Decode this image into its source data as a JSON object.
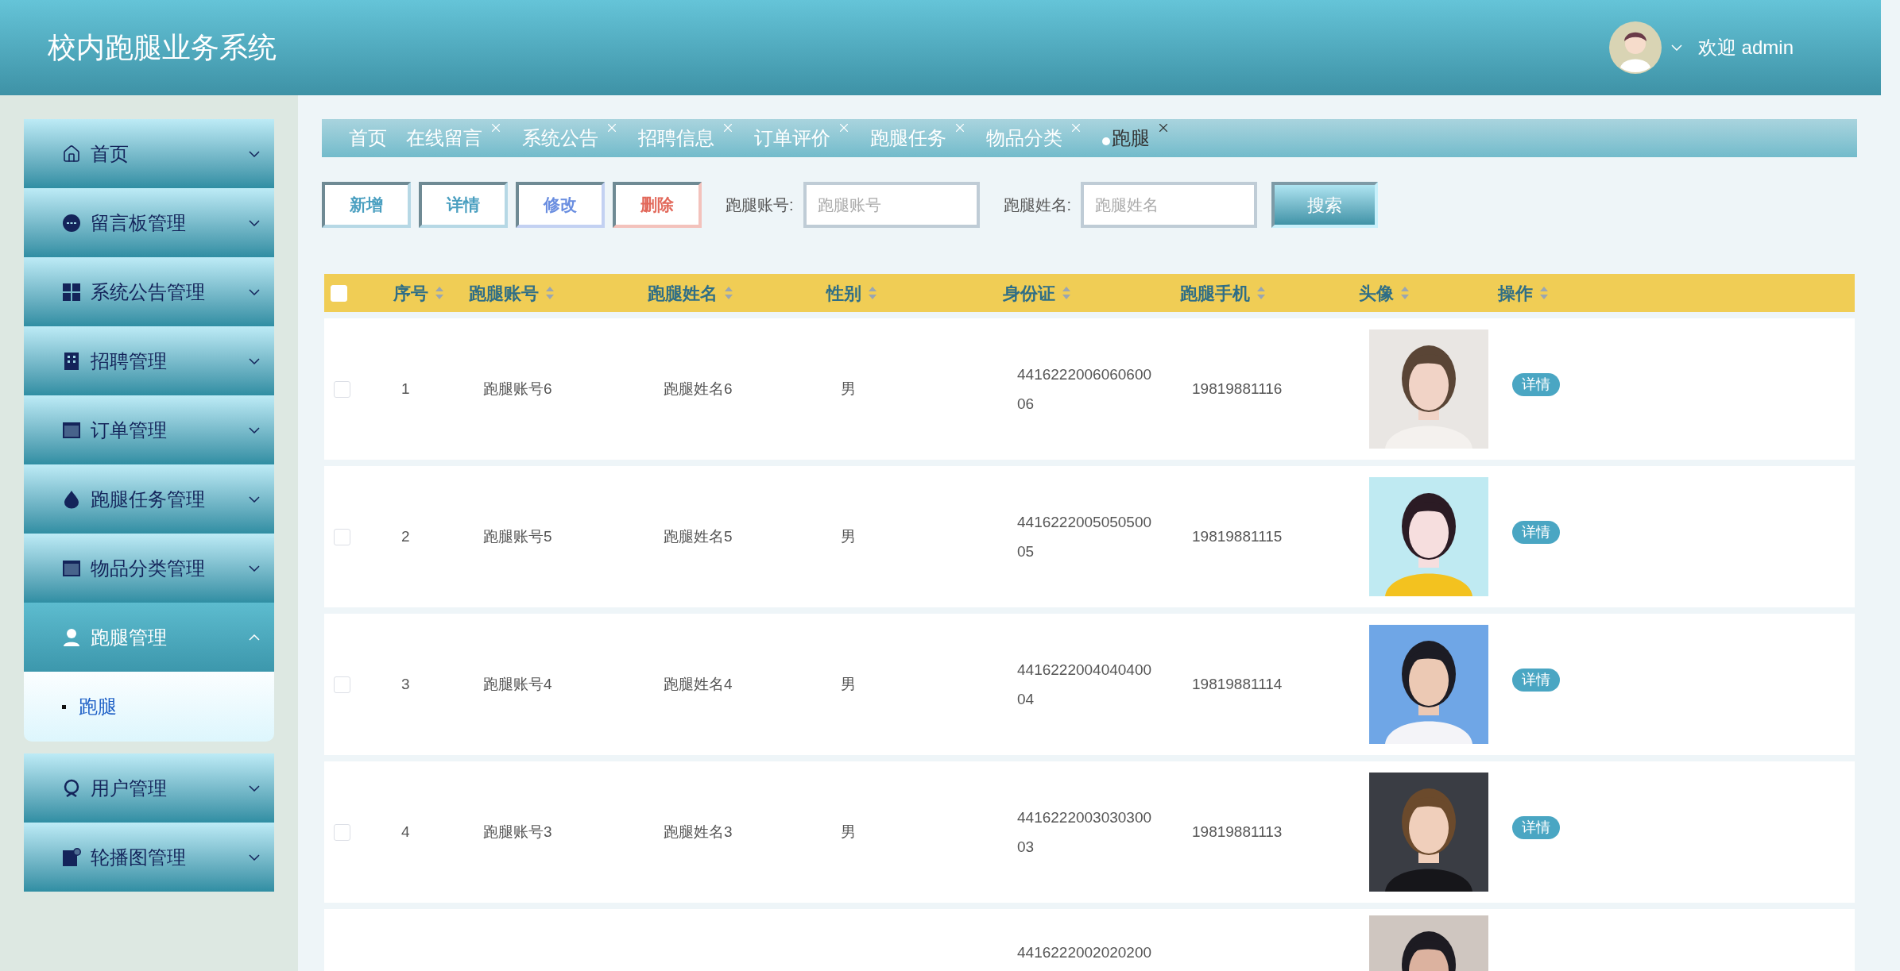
{
  "header": {
    "title": "校内跑腿业务系统",
    "welcome": "欢迎 admin"
  },
  "sidebar": {
    "items": [
      {
        "label": "首页",
        "expanded": false
      },
      {
        "label": "留言板管理",
        "expanded": false
      },
      {
        "label": "系统公告管理",
        "expanded": false
      },
      {
        "label": "招聘管理",
        "expanded": false
      },
      {
        "label": "订单管理",
        "expanded": false
      },
      {
        "label": "跑腿任务管理",
        "expanded": false
      },
      {
        "label": "物品分类管理",
        "expanded": false
      },
      {
        "label": "跑腿管理",
        "expanded": true,
        "children": [
          {
            "label": "跑腿",
            "selected": true
          }
        ]
      },
      {
        "label": "用户管理",
        "expanded": false
      },
      {
        "label": "轮播图管理",
        "expanded": false
      }
    ]
  },
  "tabs": [
    {
      "label": "首页",
      "closable": false,
      "selected": false
    },
    {
      "label": "在线留言",
      "closable": true,
      "selected": false
    },
    {
      "label": "系统公告",
      "closable": true,
      "selected": false
    },
    {
      "label": "招聘信息",
      "closable": true,
      "selected": false
    },
    {
      "label": "订单评价",
      "closable": true,
      "selected": false
    },
    {
      "label": "跑腿任务",
      "closable": true,
      "selected": false
    },
    {
      "label": "物品分类",
      "closable": true,
      "selected": false
    },
    {
      "label": "跑腿",
      "closable": true,
      "selected": true
    }
  ],
  "actions": [
    {
      "label": "新增",
      "color": "#4a9fc0"
    },
    {
      "label": "详情",
      "color": "#4a9fc0"
    },
    {
      "label": "修改",
      "color": "#6a8ee0"
    },
    {
      "label": "删除",
      "color": "#e2685a"
    }
  ],
  "filters": [
    {
      "label": "跑腿账号:",
      "placeholder": "跑腿账号"
    },
    {
      "label": "跑腿姓名:",
      "placeholder": "跑腿姓名"
    }
  ],
  "search_button": "搜索",
  "table": {
    "select_all_checked": false,
    "columns": [
      "序号",
      "跑腿账号",
      "跑腿姓名",
      "性别",
      "身份证",
      "跑腿手机",
      "头像",
      "操作"
    ],
    "rows": [
      {
        "checked": false,
        "index": "1",
        "account": "跑腿账号6",
        "name": "跑腿姓名6",
        "gender": "男",
        "id_card": [
          "4416222006060600",
          "06"
        ],
        "phone": "19819881116",
        "avatar": {
          "kind": "picture"
        },
        "action": "详情"
      },
      {
        "checked": false,
        "index": "2",
        "account": "跑腿账号5",
        "name": "跑腿姓名5",
        "gender": "男",
        "id_card": [
          "4416222005050500",
          "05"
        ],
        "phone": "19819881115",
        "avatar": {
          "kind": "picture"
        },
        "action": "详情"
      },
      {
        "checked": false,
        "index": "3",
        "account": "跑腿账号4",
        "name": "跑腿姓名4",
        "gender": "男",
        "id_card": [
          "4416222004040400",
          "04"
        ],
        "phone": "19819881114",
        "avatar": {
          "kind": "picture"
        },
        "action": "详情"
      },
      {
        "checked": false,
        "index": "4",
        "account": "跑腿账号3",
        "name": "跑腿姓名3",
        "gender": "男",
        "id_card": [
          "4416222003030300",
          "03"
        ],
        "phone": "19819881113",
        "avatar": {
          "kind": "picture"
        },
        "action": "详情"
      },
      {
        "id_card": [
          "4416222002020200"
        ],
        "avatar": {
          "kind": "picture"
        }
      }
    ]
  }
}
